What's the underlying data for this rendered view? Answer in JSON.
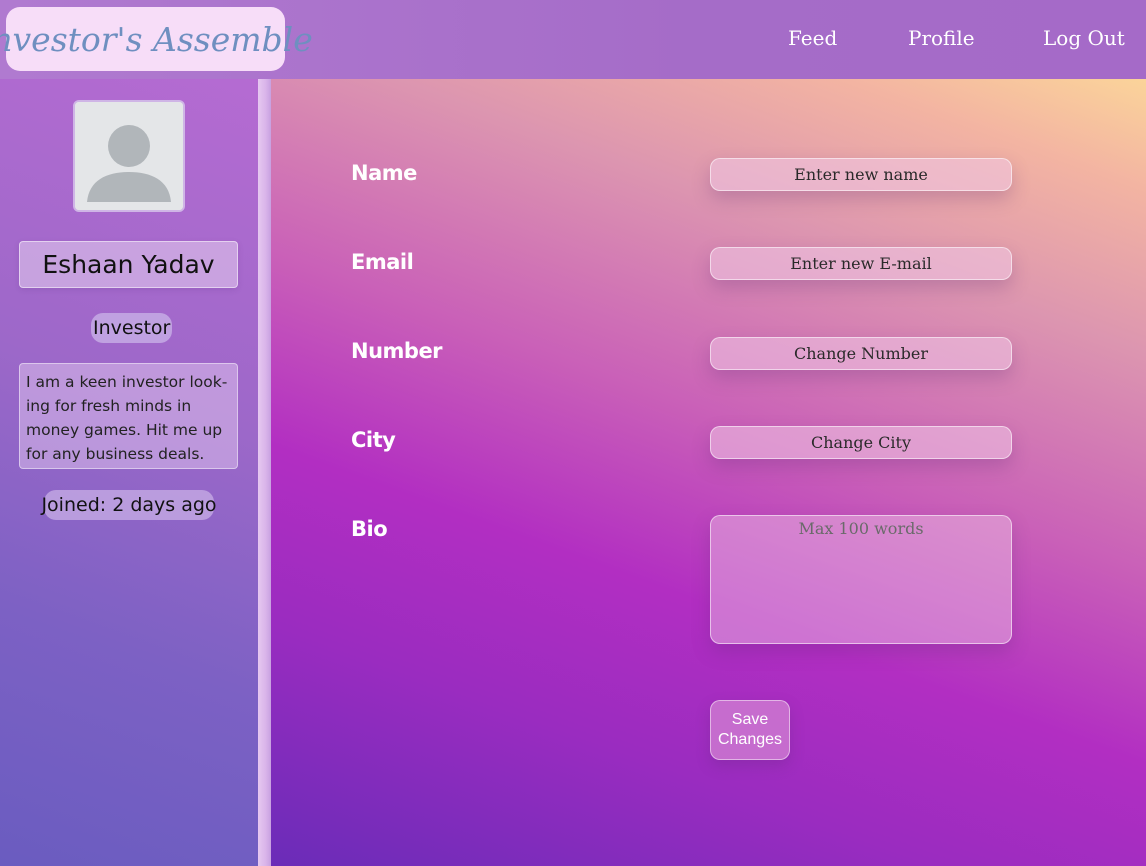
{
  "navbar": {
    "logo_text": "Investor's Assemble",
    "links": [
      {
        "label": "Feed"
      },
      {
        "label": "Profile"
      },
      {
        "label": "Log Out"
      }
    ]
  },
  "profile": {
    "avatar_icon": "user-avatar-icon",
    "name": "Eshaan Yadav",
    "role": "Investor",
    "bio": "I am a keen investor look-ing for fresh minds in money games. Hit me up for any business deals.",
    "joined": "Joined: 2 days ago"
  },
  "form": {
    "fields": [
      {
        "label": "Name",
        "placeholder": "Enter new name"
      },
      {
        "label": "Email",
        "placeholder": "Enter new E-mail"
      },
      {
        "label": "Number",
        "placeholder": "Change Number"
      },
      {
        "label": "City",
        "placeholder": "Change City"
      }
    ],
    "bio": {
      "label": "Bio",
      "placeholder": "Max 100 words"
    },
    "save_label": "Save Changes"
  },
  "colors": {
    "logo_text": "#6f8fc0",
    "logo_bg": "#f7ddf8",
    "nav_bg": "#a56cc8"
  }
}
